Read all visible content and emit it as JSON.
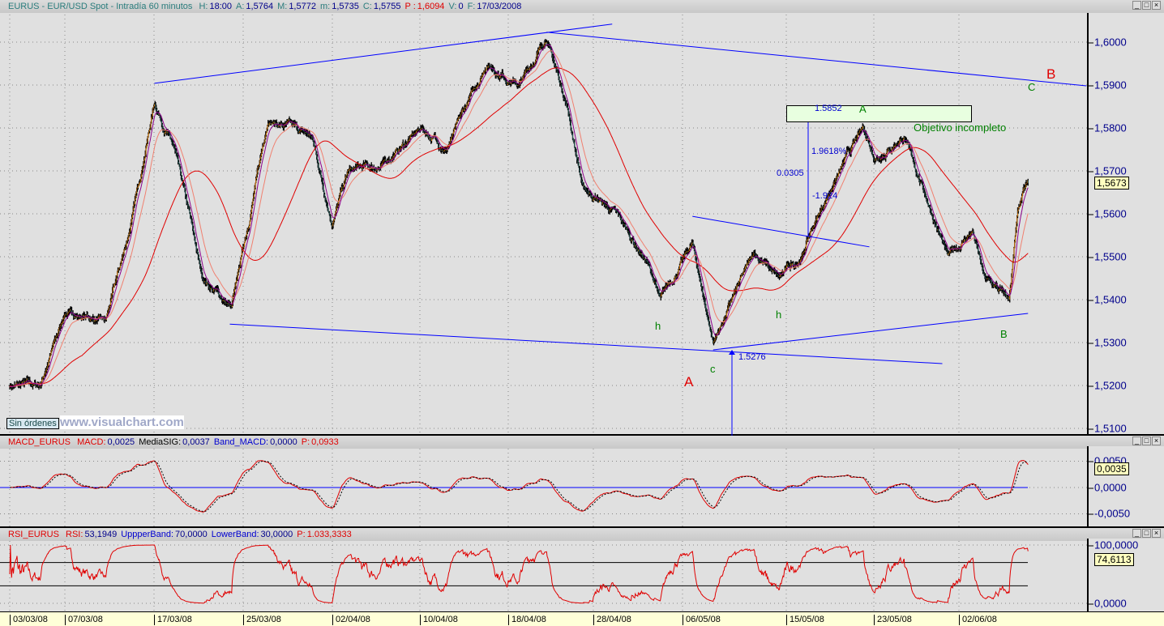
{
  "main": {
    "symbol": "EURUS - EUR/USD Spot - Intradía 60 minutos",
    "fields": [
      {
        "label": "H:",
        "value": "18:00"
      },
      {
        "label": "A:",
        "value": "1,5764"
      },
      {
        "label": "M:",
        "value": "1,5772"
      },
      {
        "label": "m:",
        "value": "1,5735"
      },
      {
        "label": "C:",
        "value": "1,5755"
      },
      {
        "label": "P :",
        "value": "1,6094"
      },
      {
        "label": "V:",
        "value": "0"
      },
      {
        "label": "F:",
        "value": "17/03/2008"
      }
    ],
    "axis_ticks": [
      "1,6000",
      "1,5900",
      "1,5800",
      "1,5700",
      "1,5600",
      "1,5500",
      "1,5400",
      "1,5300",
      "1,5200",
      "1,5100"
    ],
    "current_price": "1,5673",
    "orders_label": "Sin órdenes",
    "watermark": "www.visualchart.com",
    "annotations": {
      "B_red": "B",
      "C_green": "C",
      "A_green": "A",
      "objective": "Objetivo incompleto",
      "h1": "h",
      "h2": "h",
      "c": "c",
      "A_red": "A",
      "B_green": "B",
      "pct": "1.9618%",
      "diff": "0.0305",
      "neg_pct": "-1.924",
      "high_label": "1.5852",
      "low_label": "1.5276"
    }
  },
  "macd": {
    "name": "MACD_EURUS",
    "fields": [
      {
        "label": "MACD:",
        "value": "0,0025"
      },
      {
        "label": "MediaSIG:",
        "value": "0,0037"
      },
      {
        "label": "Band_MACD:",
        "value": "0,0000"
      },
      {
        "label": "P:",
        "value": "0,0933"
      }
    ],
    "axis_ticks": [
      "0,0050",
      "0,0000",
      "-0,0050"
    ],
    "current_value": "0,0035"
  },
  "rsi": {
    "name": "RSI_EURUS",
    "fields": [
      {
        "label": "RSI:",
        "value": "53,1949"
      },
      {
        "label": "UppperBand:",
        "value": "70,0000"
      },
      {
        "label": "LowerBand:",
        "value": "30,0000"
      },
      {
        "label": "P:",
        "value": "1.033,3333"
      }
    ],
    "axis_ticks": [
      "100,0000",
      "0,0000"
    ],
    "current_value": "74,6113"
  },
  "date_ticks": [
    "03/03/08",
    "07/03/08",
    "17/03/08",
    "25/03/08",
    "02/04/08",
    "10/04/08",
    "18/04/08",
    "28/04/08",
    "06/05/08",
    "15/05/08",
    "23/05/08",
    "02/06/08"
  ],
  "window_buttons": {
    "minimize": "_",
    "maximize": "□",
    "close": "×"
  },
  "colors": {
    "ma_fast": "#8b008b",
    "ma_mid": "#f08070",
    "ma_slow": "#e00000",
    "trendline": "#0000ff",
    "bull": "#ff8c00",
    "bear": "#2f6f6f",
    "macd": "#e00000",
    "signal": "#000000"
  },
  "chart_data": {
    "type": "candlestick",
    "title": "EURUS - EUR/USD Spot - Intradía 60 minutos",
    "timeframe": "60 minutos",
    "ylim": [
      1.508,
      1.608
    ],
    "grid": true,
    "price_path": [
      [
        "03/03/08 00:00",
        1.52
      ],
      [
        "05/03/08 02:00",
        1.52
      ],
      [
        "06/03/08 19:00",
        1.537
      ],
      [
        "11/03/08 14:00",
        1.535
      ],
      [
        "13/03/08 05:00",
        1.556
      ],
      [
        "14/03/08 22:00",
        1.586
      ],
      [
        "18/03/08 07:00",
        1.575
      ],
      [
        "20/03/08 05:00",
        1.545
      ],
      [
        "24/03/08 05:00",
        1.538
      ],
      [
        "26/03/08 17:00",
        1.582
      ],
      [
        "31/03/08 17:00",
        1.578
      ],
      [
        "02/04/08 02:00",
        1.558
      ],
      [
        "03/04/08 05:00",
        1.57
      ],
      [
        "07/04/08 10:00",
        1.571
      ],
      [
        "10/04/08 05:00",
        1.58
      ],
      [
        "11/04/08 22:00",
        1.575
      ],
      [
        "16/04/08 17:00",
        1.595
      ],
      [
        "18/04/08 22:00",
        1.59
      ],
      [
        "22/04/08 19:00",
        1.601
      ],
      [
        "24/04/08 05:00",
        1.585
      ],
      [
        "25/04/08 07:00",
        1.566
      ],
      [
        "29/04/08 14:00",
        1.56
      ],
      [
        "01/05/08 19:00",
        1.548
      ],
      [
        "02/05/08 14:00",
        1.54
      ],
      [
        "06/05/08 19:00",
        1.553
      ],
      [
        "08/05/08 05:00",
        1.53
      ],
      [
        "13/05/08 00:00",
        1.551
      ],
      [
        "14/05/08 17:00",
        1.545
      ],
      [
        "16/05/08 07:00",
        1.55
      ],
      [
        "16/05/08 22:00",
        1.556
      ],
      [
        "20/05/08 14:00",
        1.568
      ],
      [
        "22/05/08 12:00",
        1.58
      ],
      [
        "23/05/08 07:00",
        1.573
      ],
      [
        "27/05/08 07:00",
        1.578
      ],
      [
        "28/05/08 17:00",
        1.565
      ],
      [
        "30/05/08 07:00",
        1.55
      ],
      [
        "03/06/08 00:00",
        1.556
      ],
      [
        "03/06/08 19:00",
        1.545
      ],
      [
        "05/06/08 12:00",
        1.54
      ],
      [
        "06/06/08 02:00",
        1.56
      ],
      [
        "06/06/08 19:00",
        1.5673
      ]
    ],
    "trendlines": [
      [
        [
          "14/03/08 22:00",
          1.5904
        ],
        [
          "29/04/08 07:00",
          1.6042
        ]
      ],
      [
        [
          "22/04/08 19:00",
          1.6023
        ],
        [
          "12/06/08 19:00",
          1.5898
        ]
      ],
      [
        [
          "24/03/08 02:00",
          1.5343
        ],
        [
          "29/05/08 22:00",
          1.5251
        ]
      ],
      [
        [
          "08/05/08 05:00",
          1.5283
        ],
        [
          "06/06/08 19:00",
          1.5368
        ]
      ],
      [
        [
          "06/05/08 19:00",
          1.5594
        ],
        [
          "22/05/08 22:00",
          1.5523
        ]
      ]
    ],
    "macd_ylim": [
      -0.008,
      0.008
    ],
    "rsi_bands": [
      70,
      30
    ]
  }
}
